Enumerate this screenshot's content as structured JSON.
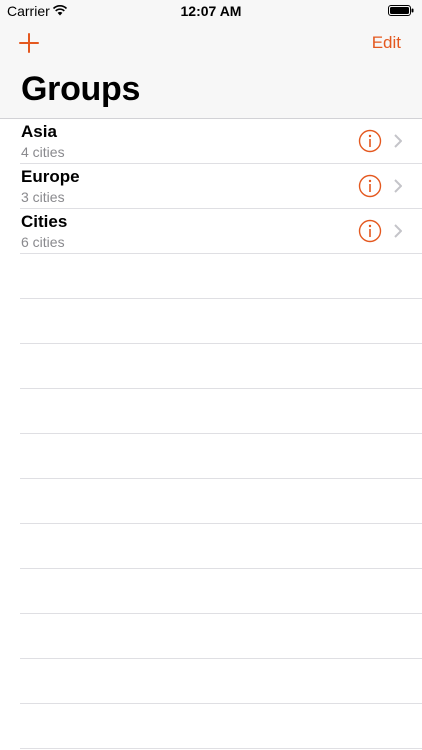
{
  "status": {
    "carrier": "Carrier",
    "time": "12:07 AM"
  },
  "nav": {
    "edit_label": "Edit",
    "title": "Groups",
    "accent": "#e4581f"
  },
  "groups": [
    {
      "name": "Asia",
      "count": "4 cities"
    },
    {
      "name": "Europe",
      "count": "3 cities"
    },
    {
      "name": "Cities",
      "count": "6 cities"
    }
  ],
  "icons": {
    "add": "plus-icon",
    "info": "info-circle-icon",
    "disclosure": "chevron-right-icon",
    "wifi": "wifi-icon",
    "battery": "battery-icon"
  }
}
